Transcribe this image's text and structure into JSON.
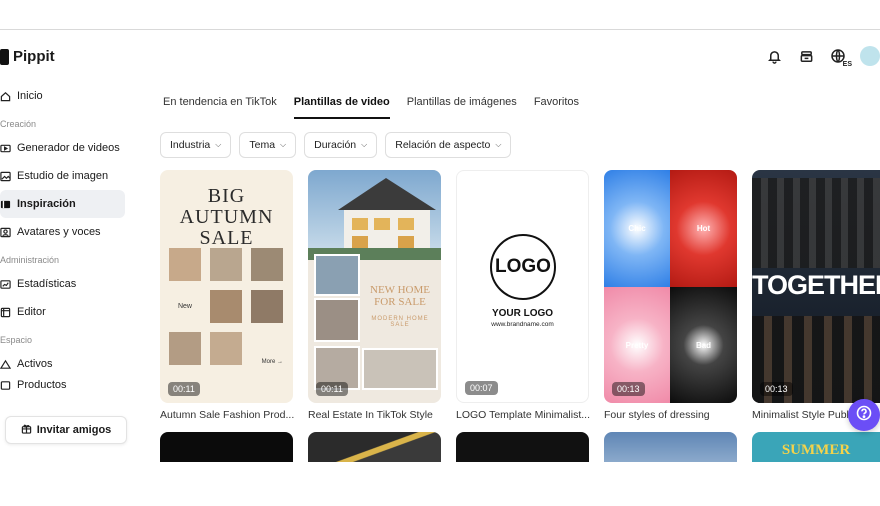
{
  "app": {
    "name": "Pippit"
  },
  "sidebar": {
    "home": "Inicio",
    "section_create": "Creación",
    "create_items": [
      "Generador de videos",
      "Estudio de imagen",
      "Inspiración",
      "Avatares y voces"
    ],
    "section_admin": "Administración",
    "admin_items": [
      "Estadísticas",
      "Editor"
    ],
    "section_space": "Espacio",
    "space_items": [
      "Activos",
      "Productos"
    ],
    "invite": "Invitar amigos"
  },
  "header": {
    "lang_badge": "ES"
  },
  "tabs": [
    "En tendencia en TikTok",
    "Plantillas de video",
    "Plantillas de imágenes",
    "Favoritos"
  ],
  "filters": [
    "Industria",
    "Tema",
    "Duración",
    "Relación de aspecto"
  ],
  "cards": [
    {
      "label": "Autumn Sale Fashion Prod...",
      "duration": "00:11",
      "headline": [
        "BIG",
        "AUTUMN",
        "SALE"
      ],
      "small_new": "New",
      "more": "More"
    },
    {
      "label": "Real Estate In TikTok Style",
      "duration": "00:11",
      "headline": "NEW HOME FOR SALE",
      "sub": "MODERN HOME SALE"
    },
    {
      "label": "LOGO Template Minimalist...",
      "duration": "00:07",
      "logo": "LOGO",
      "your_logo": "YOUR LOGO",
      "site": "www.brandname.com"
    },
    {
      "label": "Four styles of dressing",
      "duration": "00:13",
      "quads": [
        "Chic",
        "Hot",
        "Pretty",
        "Bad"
      ]
    },
    {
      "label": "Minimalist Style Publi...",
      "duration": "00:13",
      "headline": "TOGETHER"
    }
  ],
  "row2": {
    "summer_text": "SUMMER"
  },
  "colors": {
    "accent": "#6b4ef6",
    "active_bg": "#eef0f3"
  }
}
